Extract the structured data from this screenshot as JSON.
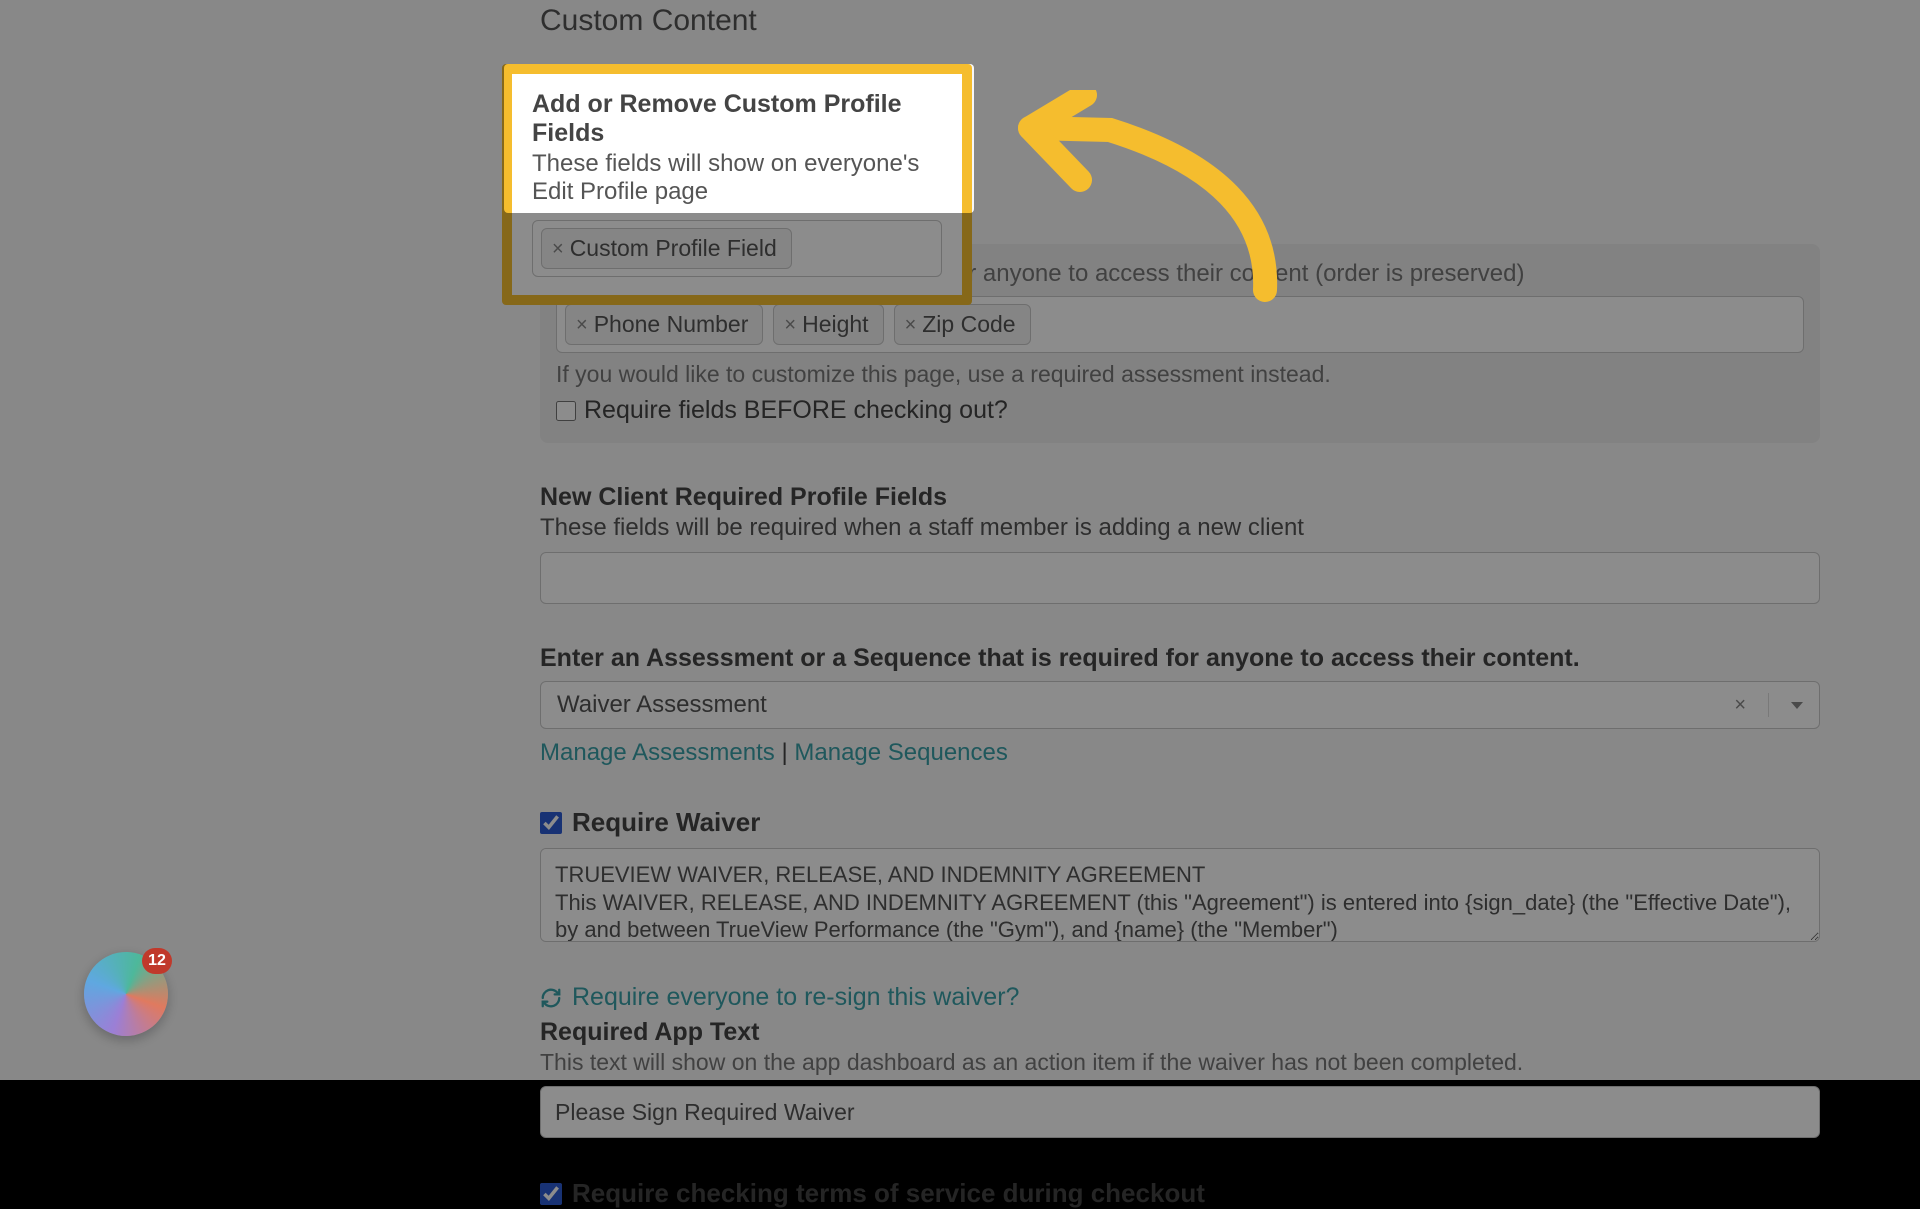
{
  "page_title": "Custom Content",
  "highlight": {
    "heading": "Add or Remove Custom Profile Fields",
    "desc": "These fields will show on everyone's Edit Profile page",
    "chip_label": "Custom Profile Field"
  },
  "required_panel": {
    "note": "Enter Profile Fields that are required for anyone to access their content (order is preserved)",
    "chips": [
      "Phone Number",
      "Height",
      "Zip Code"
    ],
    "hint": "If you would like to customize this page, use a required assessment instead.",
    "checkbox_label": "Require fields BEFORE checking out?"
  },
  "new_client": {
    "heading": "New Client Required Profile Fields",
    "desc": "These fields will be required when a staff member is adding a new client"
  },
  "assessment": {
    "heading": "Enter an Assessment or a Sequence that is required for anyone to access their content.",
    "selected": "Waiver Assessment",
    "manage_assessments": "Manage Assessments",
    "manage_sequences": "Manage Sequences",
    "separator": " | "
  },
  "waiver": {
    "checkbox_label": "Require Waiver",
    "text": "TRUEVIEW WAIVER, RELEASE, AND INDEMNITY AGREEMENT\nThis WAIVER, RELEASE, AND INDEMNITY AGREEMENT (this \"Agreement\") is entered into {sign_date} (the \"Effective Date\"), by and between TrueView Performance (the \"Gym\"), and {name} (the \"Member\")",
    "resign_label": "Require everyone to re-sign this waiver?",
    "app_text_heading": "Required App Text",
    "app_text_desc": "This text will show on the app dashboard as an action item if the waiver has not been completed.",
    "app_text_value": "Please Sign Required Waiver"
  },
  "tos": {
    "checkbox_label": "Require checking terms of service during checkout"
  },
  "orb_badge": "12"
}
